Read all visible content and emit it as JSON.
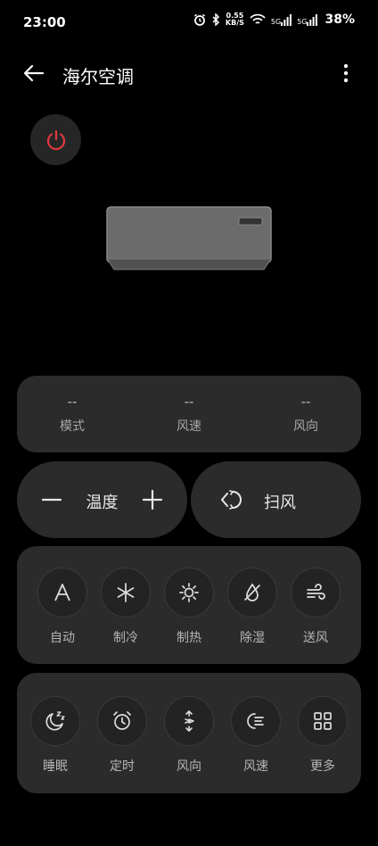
{
  "status_bar": {
    "time": "23:00",
    "net_speed_value": "0.55",
    "net_speed_unit": "KB/S",
    "sim1": "5G",
    "sim2": "5G",
    "battery": "38%"
  },
  "app_bar": {
    "title": "海尔空调"
  },
  "device": {
    "power_color": "#e0393e"
  },
  "status": {
    "mode_value": "--",
    "mode_label": "模式",
    "speed_value": "--",
    "speed_label": "风速",
    "direction_value": "--",
    "direction_label": "风向"
  },
  "controls": {
    "temp_label": "温度",
    "swing_label": "扫风"
  },
  "modes": [
    {
      "label": "自动",
      "icon": "auto-icon"
    },
    {
      "label": "制冷",
      "icon": "snowflake-icon"
    },
    {
      "label": "制热",
      "icon": "sun-icon"
    },
    {
      "label": "除湿",
      "icon": "drop-slash-icon"
    },
    {
      "label": "送风",
      "icon": "wind-icon"
    }
  ],
  "features": [
    {
      "label": "睡眠",
      "icon": "moon-zzz-icon"
    },
    {
      "label": "定时",
      "icon": "alarm-clock-icon"
    },
    {
      "label": "风向",
      "icon": "wind-direction-icon"
    },
    {
      "label": "风速",
      "icon": "wind-speed-icon"
    },
    {
      "label": "更多",
      "icon": "grid-icon"
    }
  ]
}
